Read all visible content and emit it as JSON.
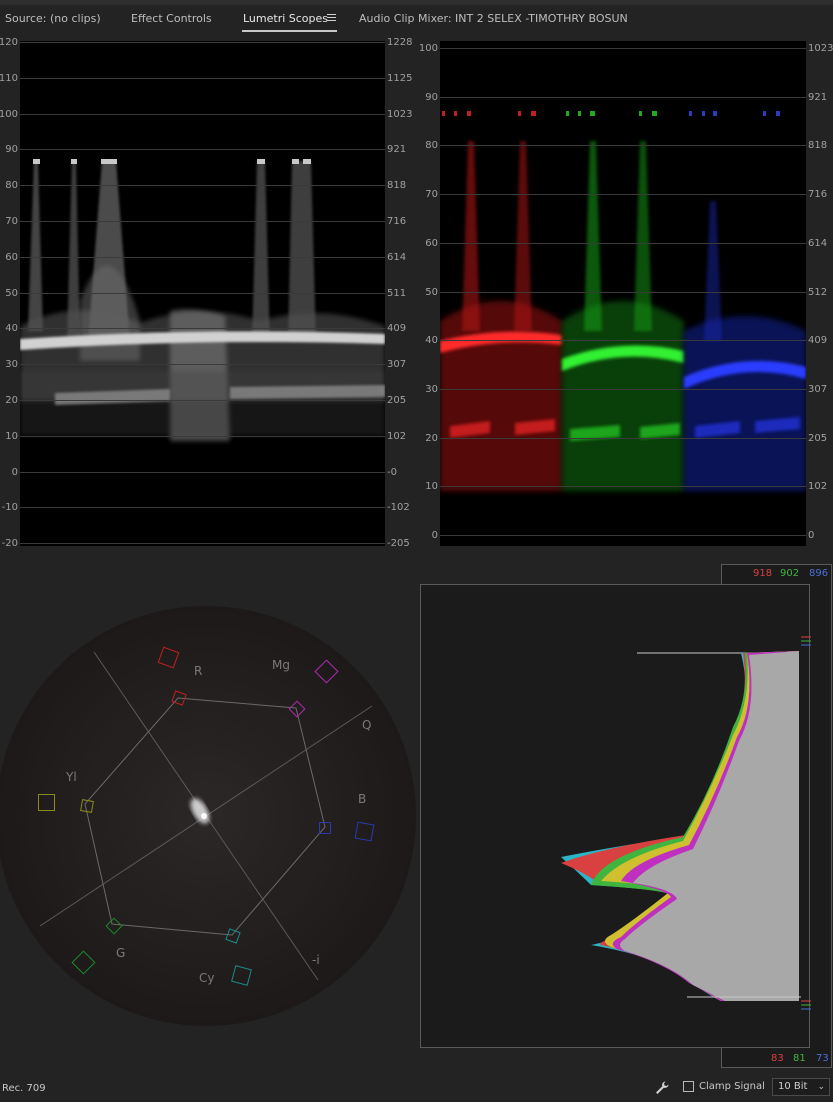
{
  "tabs": [
    {
      "label": "Source: (no clips)"
    },
    {
      "label": "Effect Controls"
    },
    {
      "label": "Lumetri Scopes"
    },
    {
      "label": "Audio Clip Mixer: INT 2 SELEX -TIMOTHRY BOSUN"
    }
  ],
  "active_tab": "Lumetri Scopes",
  "luma_waveform": {
    "left_axis": [
      "120",
      "110",
      "100",
      "90",
      "80",
      "70",
      "60",
      "50",
      "40",
      "30",
      "20",
      "10",
      "0",
      "-10",
      "-20"
    ],
    "right_axis": [
      "1228",
      "1125",
      "1023",
      "921",
      "818",
      "716",
      "614",
      "511",
      "409",
      "307",
      "205",
      "102",
      "-0",
      "-102",
      "-205"
    ]
  },
  "rgb_parade": {
    "left_axis": [
      "100",
      "90",
      "80",
      "70",
      "60",
      "50",
      "40",
      "30",
      "20",
      "10",
      "0"
    ],
    "right_axis": [
      "1023",
      "921",
      "818",
      "716",
      "614",
      "512",
      "409",
      "307",
      "205",
      "102",
      "0"
    ]
  },
  "vectorscope": {
    "targets": [
      "R",
      "Mg",
      "B",
      "Cy",
      "G",
      "Yl"
    ],
    "axis_labels": [
      "Q",
      "-i"
    ]
  },
  "histogram": {
    "top_values": {
      "red": "918",
      "green": "902",
      "blue": "896"
    },
    "bottom_values": {
      "red": "83",
      "green": "81",
      "blue": "73"
    }
  },
  "colors": {
    "red": "#d94040",
    "green": "#3fb43f",
    "blue": "#4a6fd9"
  },
  "footer": {
    "color_space": "Rec. 709",
    "clamp_signal_label": "Clamp Signal",
    "clamp_checked": false,
    "bit_depth": "10 Bit",
    "icons": [
      "wrench-icon",
      "chevron-down-icon"
    ]
  }
}
